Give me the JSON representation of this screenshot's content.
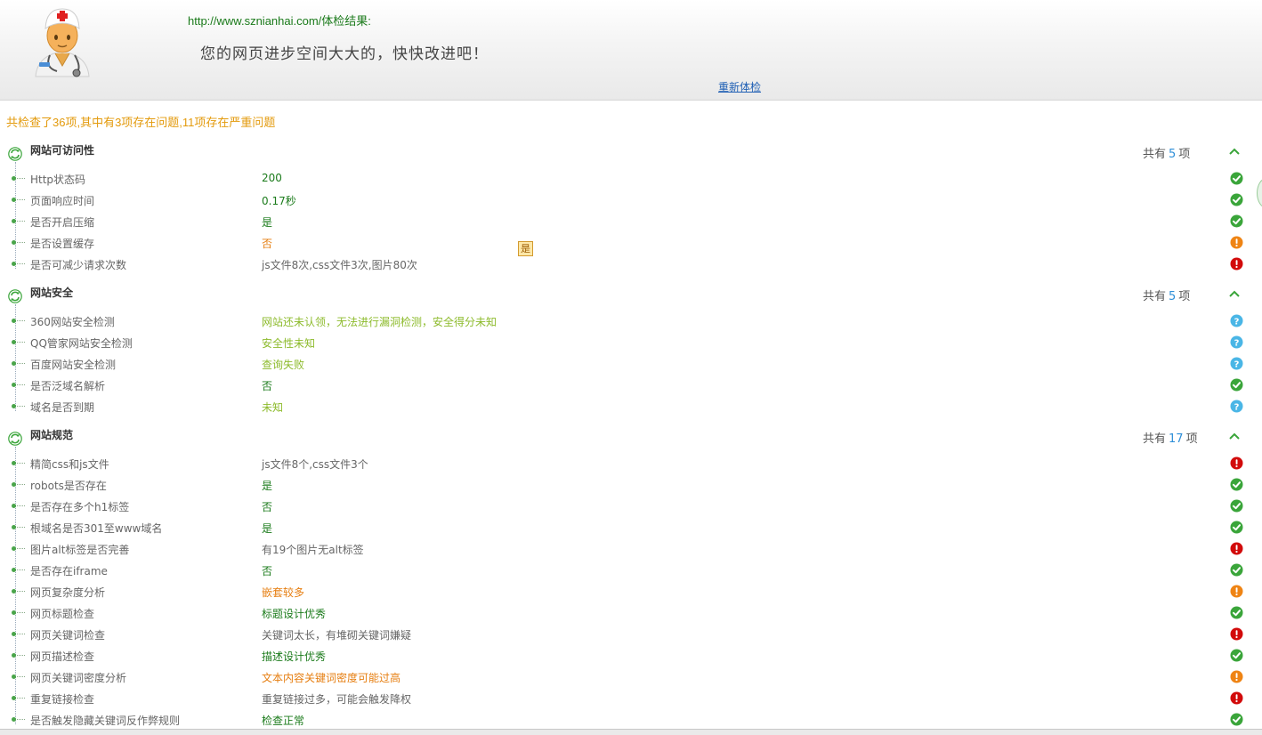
{
  "header": {
    "url_result": "http://www.sznianhai.com/体检结果:",
    "message": "您的网页进步空间大大的，快快改进吧！",
    "retest_link": "重新体检"
  },
  "summary": "共检查了36项,其中有3项存在问题,11项存在严重问题",
  "colors": {
    "ok": "#1b7b1b",
    "warn": "#e67e10",
    "error": "#d20b0b",
    "info": "#8dbb2c",
    "count_number": "#2f8fd8"
  },
  "sections": [
    {
      "title": "网站可访问性",
      "count_prefix": "共有",
      "count": "5",
      "count_suffix": "项",
      "rows": [
        {
          "label": "Http状态码",
          "value": "200",
          "status": "ok"
        },
        {
          "label": "页面响应时间",
          "value": "0.17秒",
          "status": "ok"
        },
        {
          "label": "是否开启压缩",
          "value": "是",
          "status": "ok"
        },
        {
          "label": "是否设置缓存",
          "value": "否",
          "status": "warn"
        },
        {
          "label": "是否可减少请求次数",
          "value": "js文件8次,css文件3次,图片80次",
          "status": "error"
        }
      ]
    },
    {
      "title": "网站安全",
      "count_prefix": "共有",
      "count": "5",
      "count_suffix": "项",
      "rows": [
        {
          "label": "360网站安全检测",
          "value": "网站还未认领，无法进行漏洞检测，安全得分未知",
          "status": "info"
        },
        {
          "label": "QQ管家网站安全检测",
          "value": "安全性未知",
          "status": "info"
        },
        {
          "label": "百度网站安全检测",
          "value": "查询失败",
          "status": "info"
        },
        {
          "label": "是否泛域名解析",
          "value": "否",
          "status": "ok"
        },
        {
          "label": "域名是否到期",
          "value": "未知",
          "status": "info"
        }
      ]
    },
    {
      "title": "网站规范",
      "count_prefix": "共有",
      "count": "17",
      "count_suffix": "项",
      "rows": [
        {
          "label": "精简css和js文件",
          "value": "js文件8个,css文件3个",
          "status": "error"
        },
        {
          "label": "robots是否存在",
          "value": "是",
          "status": "ok"
        },
        {
          "label": "是否存在多个h1标签",
          "value": "否",
          "status": "ok"
        },
        {
          "label": "根域名是否301至www域名",
          "value": "是",
          "status": "ok"
        },
        {
          "label": "图片alt标签是否完善",
          "value": "有19个图片无alt标签",
          "status": "error"
        },
        {
          "label": "是否存在iframe",
          "value": "否",
          "status": "ok"
        },
        {
          "label": "网页复杂度分析",
          "value": "嵌套较多",
          "status": "warn"
        },
        {
          "label": "网页标题检查",
          "value": "标题设计优秀",
          "status": "ok"
        },
        {
          "label": "网页关键词检查",
          "value": "关键词太长，有堆砌关键词嫌疑",
          "status": "error"
        },
        {
          "label": "网页描述检查",
          "value": "描述设计优秀",
          "status": "ok"
        },
        {
          "label": "网页关键词密度分析",
          "value": "文本内容关键词密度可能过高",
          "status": "warn"
        },
        {
          "label": "重复链接检查",
          "value": "重复链接过多，可能会触发降权",
          "status": "error"
        },
        {
          "label": "是否触发隐藏关键词反作弊规则",
          "value": "检查正常",
          "status": "ok"
        }
      ]
    }
  ],
  "floating_badge": "是",
  "icons": {
    "avatar": "doctor-avatar-icon",
    "section": "refresh-cycle-icon",
    "toggle": "chevron-up-icon",
    "ok": "check-circle-icon",
    "warn": "warning-circle-icon",
    "error": "error-circle-icon",
    "info": "question-circle-icon"
  }
}
